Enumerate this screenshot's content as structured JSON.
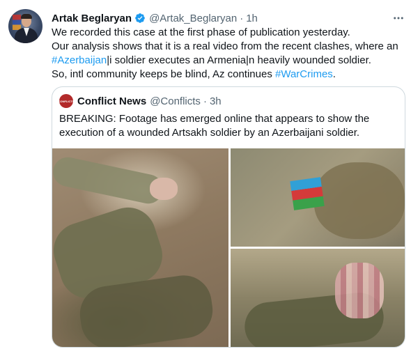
{
  "tweet": {
    "author_name": "Artak Beglaryan",
    "author_handle": "@Artak_Beglaryan",
    "separator": "·",
    "time": "1h",
    "text_lines": {
      "l1": "We  recorded this case at the first phase of publication yesterday.",
      "l2": "Our analysis shows that it is a real video from the recent clashes, where an",
      "l3_tag": "#Azerbaijan",
      "l3_rest": "|i soldier executes an Armenia|n heavily wounded soldier.",
      "l4_pre": "So, intl community keeps be blind, Az continues ",
      "l4_tag": "#WarCrimes",
      "l4_post": "."
    }
  },
  "quoted_tweet": {
    "avatar_text": "CONFLICTS",
    "author_name": "Conflict News",
    "author_handle": "@Conflicts",
    "separator": "·",
    "time": "3h",
    "text_line1": "BREAKING: Footage has emerged online that appears to show the",
    "text_line2": "execution of a wounded Artsakh soldier by an Azerbaijani soldier."
  },
  "colors": {
    "link": "#1d9bf0",
    "secondary_text": "#536471",
    "border": "#cfd9de",
    "verified": "#1d9bf0"
  },
  "icons": [
    "verified-badge-icon",
    "more-options-icon"
  ]
}
